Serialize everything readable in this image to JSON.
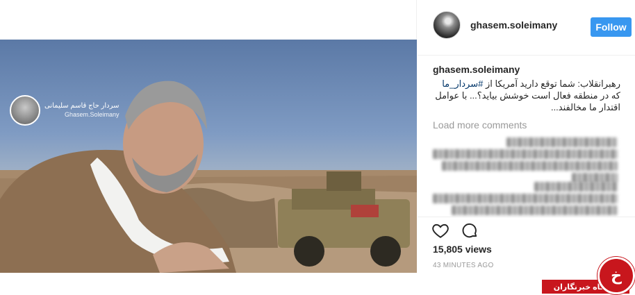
{
  "post": {
    "username": "ghasem.soleimany",
    "follow_label": "Follow",
    "caption_username": "ghasem.soleimany",
    "caption_part1": "رهبرانقلاب: شما توقع دارید آمریکا از ",
    "caption_hashtag": "#سردار_ما",
    "caption_part2": " که در منطقه فعال است خوشش بیاید؟... با عوامل اقتدار ما مخالفند...",
    "load_more": "Load more comments",
    "views": "15,805 views",
    "time_ago": "43 MINUTES AGO"
  },
  "watermark": {
    "line1": "سردار حاج قاسم سلیمانی",
    "line2": "Ghasem.Soleimany"
  },
  "site_badge": {
    "label": "باشگاه خبرنگاران",
    "glyph": "خ"
  },
  "icons": {
    "like": "heart-icon",
    "comment": "comment-icon"
  }
}
